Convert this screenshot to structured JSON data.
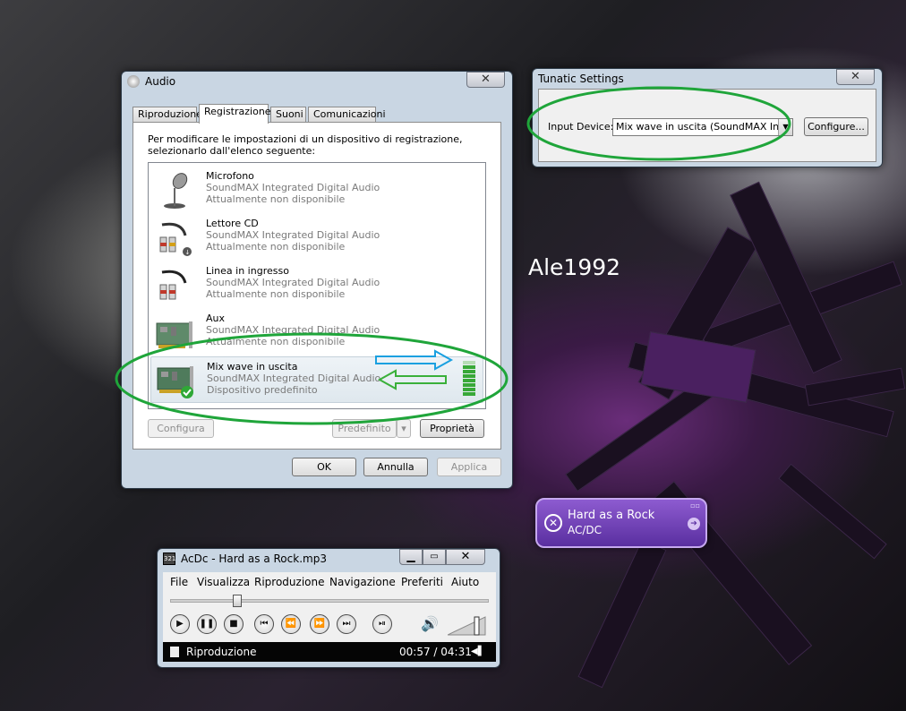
{
  "watermark": "Ale1992",
  "audio": {
    "title": "Audio",
    "close": "✕",
    "tabs": [
      "Riproduzione",
      "Registrazione",
      "Suoni",
      "Comunicazioni"
    ],
    "instructions_line1": "Per modificare le impostazioni di un dispositivo di registrazione,",
    "instructions_line2": "selezionarlo dall'elenco seguente:",
    "devices": [
      {
        "name": "Microfono",
        "driver": "SoundMAX Integrated Digital Audio",
        "status": "Attualmente non disponibile",
        "icon": "microphone-icon"
      },
      {
        "name": "Lettore CD",
        "driver": "SoundMAX Integrated Digital Audio",
        "status": "Attualmente non disponibile",
        "icon": "cd-cable-icon"
      },
      {
        "name": "Linea in ingresso",
        "driver": "SoundMAX Integrated Digital Audio",
        "status": "Attualmente non disponibile",
        "icon": "line-in-cable-icon"
      },
      {
        "name": "Aux",
        "driver": "SoundMAX Integrated Digital Audio",
        "status": "Attualmente non disponibile",
        "icon": "sound-card-icon"
      },
      {
        "name": "Mix wave in uscita",
        "driver": "SoundMAX Integrated Digital Audio",
        "status": "Dispositivo predefinito",
        "icon": "sound-card-default-icon"
      }
    ],
    "configura": "Configura",
    "predefinito": "Predefinito",
    "proprieta": "Proprietà",
    "ok": "OK",
    "annulla": "Annulla",
    "applica": "Applica"
  },
  "tunatic": {
    "title": "Tunatic Settings",
    "close": "✕",
    "input_label": "Input Device:",
    "input_value": "Mix wave in uscita (SoundMAX Integr",
    "configure": "Configure..."
  },
  "notification": {
    "track": "Hard as a Rock",
    "artist": "AC/DC"
  },
  "player": {
    "title": "AcDc - Hard as a Rock.mp3",
    "menu": [
      "File",
      "Visualizza",
      "Riproduzione",
      "Navigazione",
      "Preferiti",
      "Aiuto"
    ],
    "status": "Riproduzione",
    "time": "00:57 / 04:31",
    "progress": 0.21
  },
  "colors": {
    "annotation_green": "#1fa53a",
    "annotation_blue": "#1aa0e0",
    "meter_green": "#38a838"
  }
}
